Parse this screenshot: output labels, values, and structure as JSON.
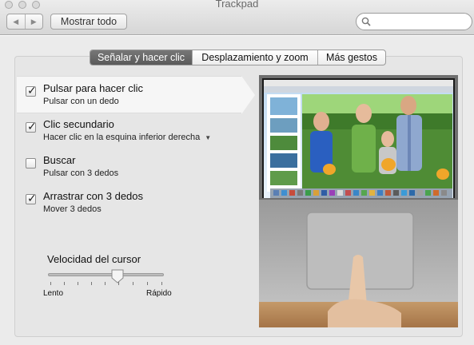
{
  "window": {
    "title": "Trackpad"
  },
  "toolbar": {
    "back_icon": "chevron-left-icon",
    "forward_icon": "chevron-right-icon",
    "show_all_label": "Mostrar todo",
    "search": {
      "value": "",
      "placeholder": ""
    }
  },
  "tabs": [
    {
      "label": "Señalar y hacer clic",
      "active": true
    },
    {
      "label": "Desplazamiento y zoom",
      "active": false
    },
    {
      "label": "Más gestos",
      "active": false
    }
  ],
  "options": [
    {
      "title": "Pulsar para hacer clic",
      "subtitle": "Pulsar con un dedo",
      "checked": true
    },
    {
      "title": "Clic secundario",
      "subtitle": "Hacer clic en la esquina inferior derecha",
      "checked": true,
      "has_dropdown": true
    },
    {
      "title": "Buscar",
      "subtitle": "Pulsar con 3 dedos",
      "checked": false
    },
    {
      "title": "Arrastrar con 3 dedos",
      "subtitle": "Mover 3 dedos",
      "checked": true
    }
  ],
  "cursor_speed": {
    "label": "Velocidad del cursor",
    "min_label": "Lento",
    "max_label": "Rápido",
    "value_fraction": 0.6
  },
  "colors": {
    "active_tab": "#666666",
    "panel": "#e6e6e6",
    "highlight": "#f6f6f6"
  }
}
